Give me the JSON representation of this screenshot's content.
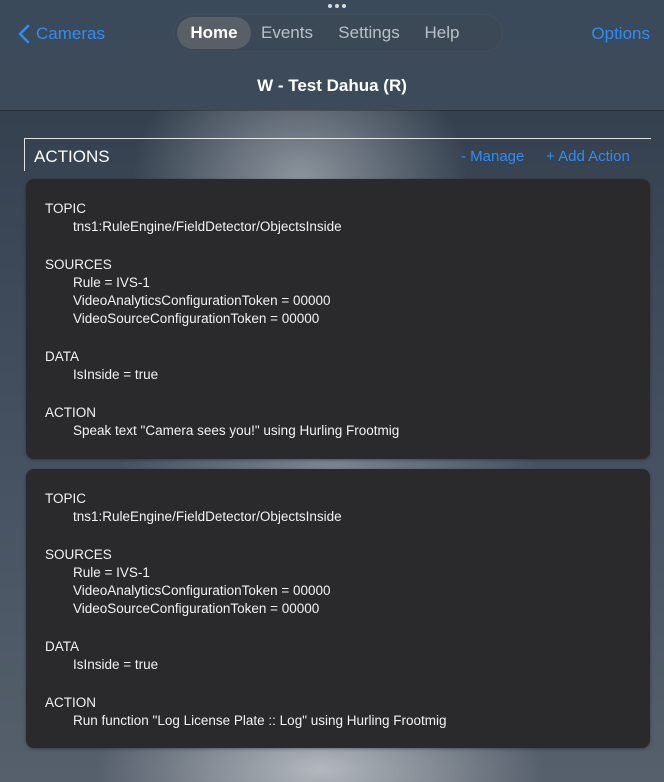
{
  "nav": {
    "back_label": "Cameras",
    "options_label": "Options",
    "tabs": [
      {
        "label": "Home",
        "active": true
      },
      {
        "label": "Events",
        "active": false
      },
      {
        "label": "Settings",
        "active": false
      },
      {
        "label": "Help",
        "active": false
      }
    ],
    "title": "W - Test Dahua (R)"
  },
  "actions": {
    "header": "ACTIONS",
    "manage_label": "- Manage",
    "add_label": "+ Add Action"
  },
  "cards": [
    {
      "topic_label": "TOPIC",
      "topic": "tns1:RuleEngine/FieldDetector/ObjectsInside",
      "sources_label": "SOURCES",
      "sources": [
        "Rule = IVS-1",
        "VideoAnalyticsConfigurationToken = 00000",
        "VideoSourceConfigurationToken = 00000"
      ],
      "data_label": "DATA",
      "data": "IsInside = true",
      "action_label": "ACTION",
      "action": "Speak text \"Camera sees you!\" using Hurling Frootmig"
    },
    {
      "topic_label": "TOPIC",
      "topic": "tns1:RuleEngine/FieldDetector/ObjectsInside",
      "sources_label": "SOURCES",
      "sources": [
        "Rule = IVS-1",
        "VideoAnalyticsConfigurationToken = 00000",
        "VideoSourceConfigurationToken = 00000"
      ],
      "data_label": "DATA",
      "data": "IsInside = true",
      "action_label": "ACTION",
      "action": "Run function \"Log License Plate :: Log\" using Hurling Frootmig"
    }
  ],
  "colors": {
    "accent": "#2f8cf5",
    "card_bg": "#2a2a2c",
    "nav_bg": "#3b4a5a"
  }
}
